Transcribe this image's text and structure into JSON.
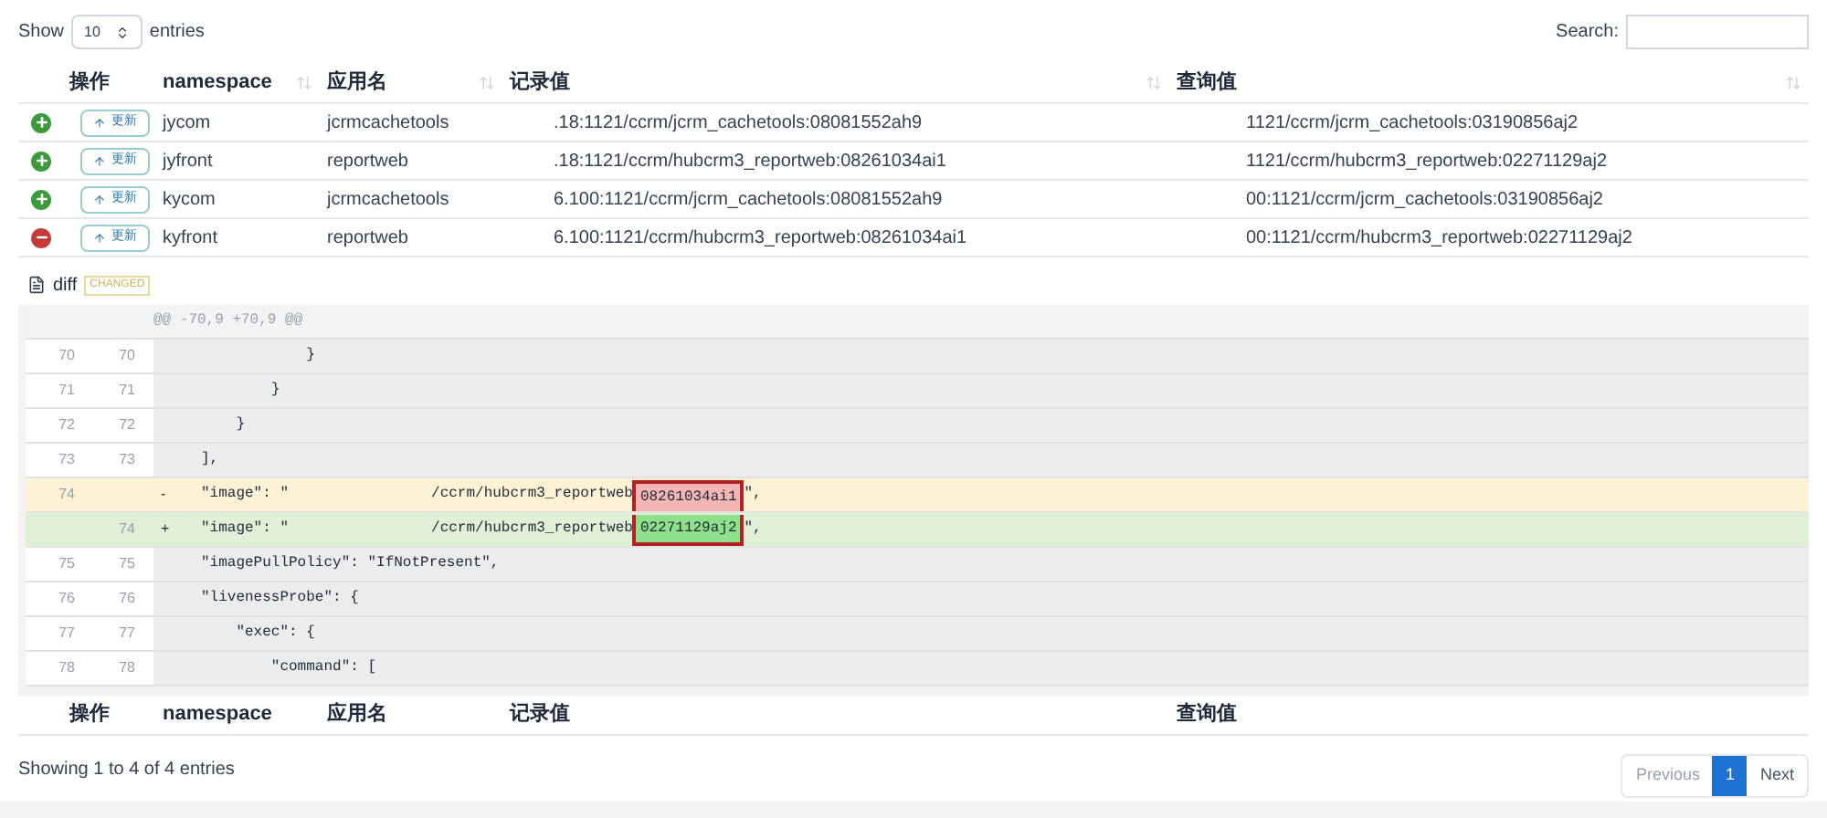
{
  "length_menu": {
    "before": "Show",
    "value": "10",
    "after": "entries"
  },
  "search": {
    "label": "Search:"
  },
  "columns": [
    "操作",
    "namespace",
    "应用名",
    "记录值",
    "查询值"
  ],
  "rows": [
    {
      "kind": "added",
      "button": "更新",
      "namespace": "jycom",
      "app": "jcrmcachetools",
      "record": ".18:1121/ccrm/jcrm_cachetools:08081552ah9",
      "query": "1121/ccrm/jcrm_cachetools:03190856aj2"
    },
    {
      "kind": "added",
      "button": "更新",
      "namespace": "jyfront",
      "app": "reportweb",
      "record": ".18:1121/ccrm/hubcrm3_reportweb:08261034ai1",
      "query": "1121/ccrm/hubcrm3_reportweb:02271129aj2"
    },
    {
      "kind": "added",
      "button": "更新",
      "namespace": "kycom",
      "app": "jcrmcachetools",
      "record": "6.100:1121/ccrm/jcrm_cachetools:08081552ah9",
      "query": "00:1121/ccrm/jcrm_cachetools:03190856aj2"
    },
    {
      "kind": "removed",
      "button": "更新",
      "namespace": "kyfront",
      "app": "reportweb",
      "record": "6.100:1121/ccrm/hubcrm3_reportweb:08261034ai1",
      "query": "00:1121/ccrm/hubcrm3_reportweb:02271129aj2"
    }
  ],
  "diff": {
    "title": "diff",
    "badge": "CHANGED",
    "lines": [
      {
        "kind": "hunk",
        "code": "@@ -70,9 +70,9 @@"
      },
      {
        "kind": "context",
        "old": "70",
        "new": "70",
        "code": "            }"
      },
      {
        "kind": "context",
        "old": "71",
        "new": "71",
        "code": "        }"
      },
      {
        "kind": "context",
        "old": "72",
        "new": "72",
        "code": "    }"
      },
      {
        "kind": "context",
        "old": "73",
        "new": "73",
        "code": "],"
      },
      {
        "kind": "removed",
        "old": "74",
        "sign": "-",
        "code": "\"image\": \"",
        "path": "/ccrm/hubcrm3_reportweb",
        "hash": "08261034ai1",
        "tail": "\","
      },
      {
        "kind": "added",
        "new": "74",
        "sign": "+",
        "code": "\"image\": \"",
        "path": "/ccrm/hubcrm3_reportweb",
        "hash": "02271129aj2",
        "tail": "\","
      },
      {
        "kind": "context",
        "old": "75",
        "new": "75",
        "code": "\"imagePullPolicy\": \"IfNotPresent\","
      },
      {
        "kind": "context",
        "old": "76",
        "new": "76",
        "code": "\"livenessProbe\": {"
      },
      {
        "kind": "context",
        "old": "77",
        "new": "77",
        "code": "    \"exec\": {"
      },
      {
        "kind": "context",
        "old": "78",
        "new": "78",
        "code": "        \"command\": ["
      }
    ]
  },
  "footer_columns": [
    "操作",
    "namespace",
    "应用名",
    "记录值",
    "查询值"
  ],
  "info": "Showing 1 to 4 of 4 entries",
  "pagination": [
    {
      "label": "Previous",
      "disabled": true,
      "selected": false
    },
    {
      "label": "1",
      "disabled": false,
      "selected": true
    },
    {
      "label": "Next",
      "disabled": false,
      "selected": false
    }
  ]
}
